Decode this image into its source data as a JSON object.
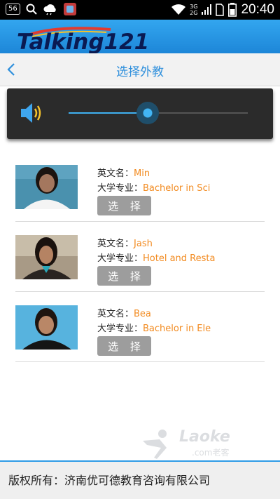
{
  "status_bar": {
    "notification_badge": "56",
    "network_top": "3G",
    "network_bottom": "2G",
    "time": "20:40",
    "icons": [
      "notification-badge-icon",
      "search-icon",
      "cloud-icon",
      "app-icon",
      "wifi-icon",
      "signal-icon",
      "sim-icon",
      "battery-icon"
    ]
  },
  "header": {
    "logo_text": "Talking121"
  },
  "nav": {
    "title": "选择外教",
    "back_icon": "chevron-left-icon"
  },
  "audio": {
    "volume": 0.44,
    "accent": "#3fb0f0",
    "icon": "speaker-icon"
  },
  "labels": {
    "english_name": "英文名：",
    "major": "大学专业：",
    "select": "选 择"
  },
  "teachers": [
    {
      "name": "Min",
      "major": "Bachelor in Sci"
    },
    {
      "name": "Jash",
      "major": "Hotel and Resta"
    },
    {
      "name": "Bea",
      "major": "Bachelor in Ele"
    }
  ],
  "watermark": {
    "text": "Laoke",
    "sub": ".com老客"
  },
  "footer": {
    "text": "版权所有：济南优可德教育咨询有限公司"
  },
  "colors": {
    "primary": "#2e8fdc",
    "highlight": "#f28a1f",
    "button": "#9d9d9d"
  }
}
